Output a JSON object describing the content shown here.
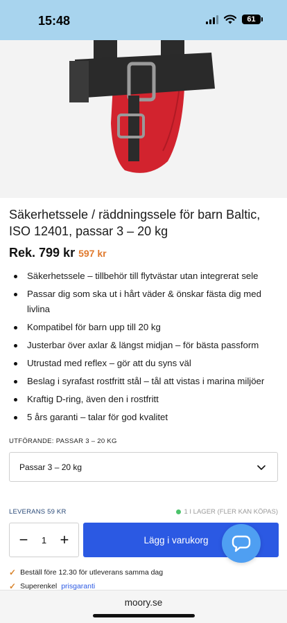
{
  "status": {
    "time": "15:48",
    "battery": "61"
  },
  "product": {
    "title": "Säkerhetssele / räddningssele för barn Baltic, ISO 12401, passar 3 – 20 kg",
    "price_old": "Rek. 799 kr",
    "price_new": "597 kr",
    "features": [
      "Säkerhetssele – tillbehör till flytvästar utan integrerat sele",
      "Passar dig som ska ut i hårt väder & önskar fästa dig med livlina",
      "Kompatibel för barn upp till 20 kg",
      "Justerbar över axlar & längst midjan – för bästa passform",
      "Utrustad med reflex – gör att du syns väl",
      "Beslag i syrafast rostfritt stål – tål att vistas i marina miljöer",
      "Kraftig D-ring, även den i rostfritt",
      "5 års garanti – talar för god kvalitet"
    ]
  },
  "variant": {
    "label": "UTFÖRANDE: PASSAR 3 – 20 KG",
    "selected": "Passar 3 – 20 kg"
  },
  "delivery": {
    "label": "LEVERANS 59 KR",
    "stock": "1 I LAGER (FLER KAN KÖPAS)"
  },
  "cart": {
    "quantity": "1",
    "add_label": "Lägg i varukorg"
  },
  "usps": {
    "order_text": "Beställ före 12.30 för utleverans samma dag",
    "guarantee_prefix": "Superenkel",
    "guarantee_link": "prisgaranti"
  },
  "browser": {
    "url": "moory.se"
  },
  "colors": {
    "accent": "#2b59e3",
    "sale": "#e07a2e",
    "status_bar": "#a8d4ee",
    "chat": "#4f9ff2"
  }
}
